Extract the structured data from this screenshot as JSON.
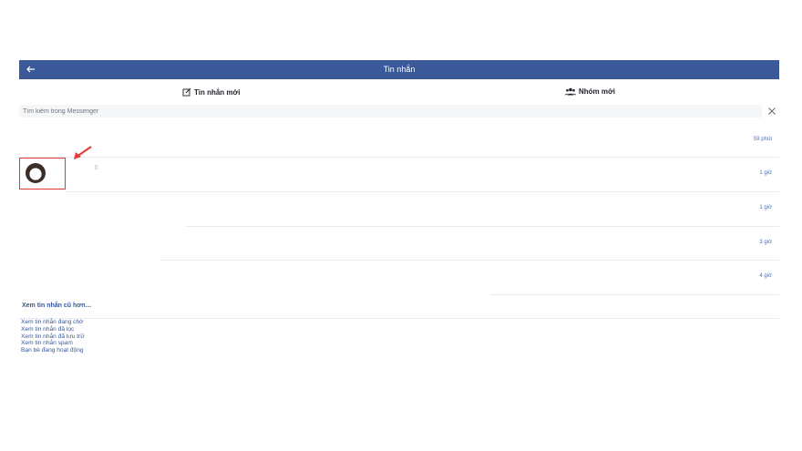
{
  "header": {
    "title": "Tin nhắn",
    "back_icon": "arrow-left-icon"
  },
  "actions": {
    "new_message": "Tin nhắn mới",
    "new_group": "Nhóm mới"
  },
  "search": {
    "placeholder": "Tìm kiếm trong Messenger"
  },
  "conversations": [
    {
      "time": "59 phút"
    },
    {
      "time": "1 giờ"
    },
    {
      "time": "1 giờ"
    },
    {
      "time": "3 giờ"
    },
    {
      "time": "4 giờ"
    }
  ],
  "older_link": "Xem tin nhắn cũ hơn…",
  "footer_links": [
    "Xem tin nhắn đang chờ",
    "Xem tin nhắn đã lọc",
    "Xem tin nhắn đã lưu trữ",
    "Xem tin nhắn spam",
    "Bạn bè đang hoạt động"
  ],
  "colors": {
    "header_bg": "#3b5998",
    "link": "#365899",
    "highlight": "#e53935"
  }
}
